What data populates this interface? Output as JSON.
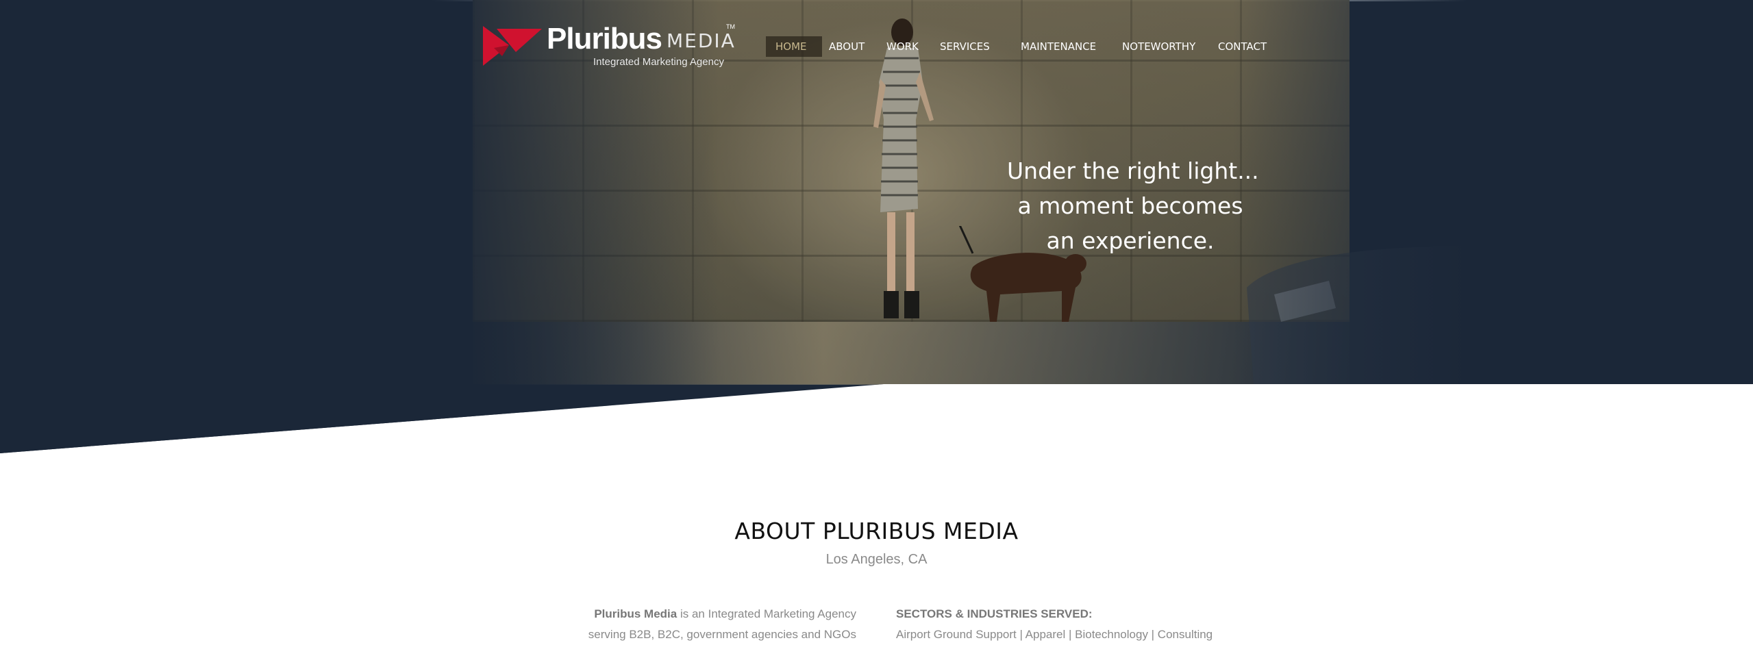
{
  "brand": {
    "name": "Pluribus",
    "media": "MEDIA",
    "trademark": "TM",
    "tagline": "Integrated Marketing Agency",
    "accent": "#d0122f"
  },
  "nav": {
    "items": [
      {
        "label": "HOME",
        "active": true
      },
      {
        "label": "ABOUT",
        "active": false
      },
      {
        "label": "WORK",
        "active": false
      },
      {
        "label": "SERVICES",
        "active": false
      },
      {
        "label": "MAINTENANCE",
        "active": false
      },
      {
        "label": "NOTEWORTHY",
        "active": false
      },
      {
        "label": "CONTACT",
        "active": false
      }
    ],
    "active_color": "#c9b98e"
  },
  "hero": {
    "lines": [
      "Under the right light...",
      "a moment becomes",
      "an experience."
    ],
    "background_color": "#1b2738"
  },
  "about": {
    "title": "ABOUT PLURIBUS MEDIA",
    "location": "Los Angeles, CA",
    "intro_brand": "Pluribus Media",
    "intro_rest": " is an Integrated Marketing Agency",
    "intro_line2": "serving B2B, B2C, government agencies and NGOs",
    "sectors_heading": "SECTORS & INDUSTRIES SERVED:",
    "sectors_line": "Airport Ground Support  |  Apparel  |  Biotechnology  |  Consulting"
  }
}
